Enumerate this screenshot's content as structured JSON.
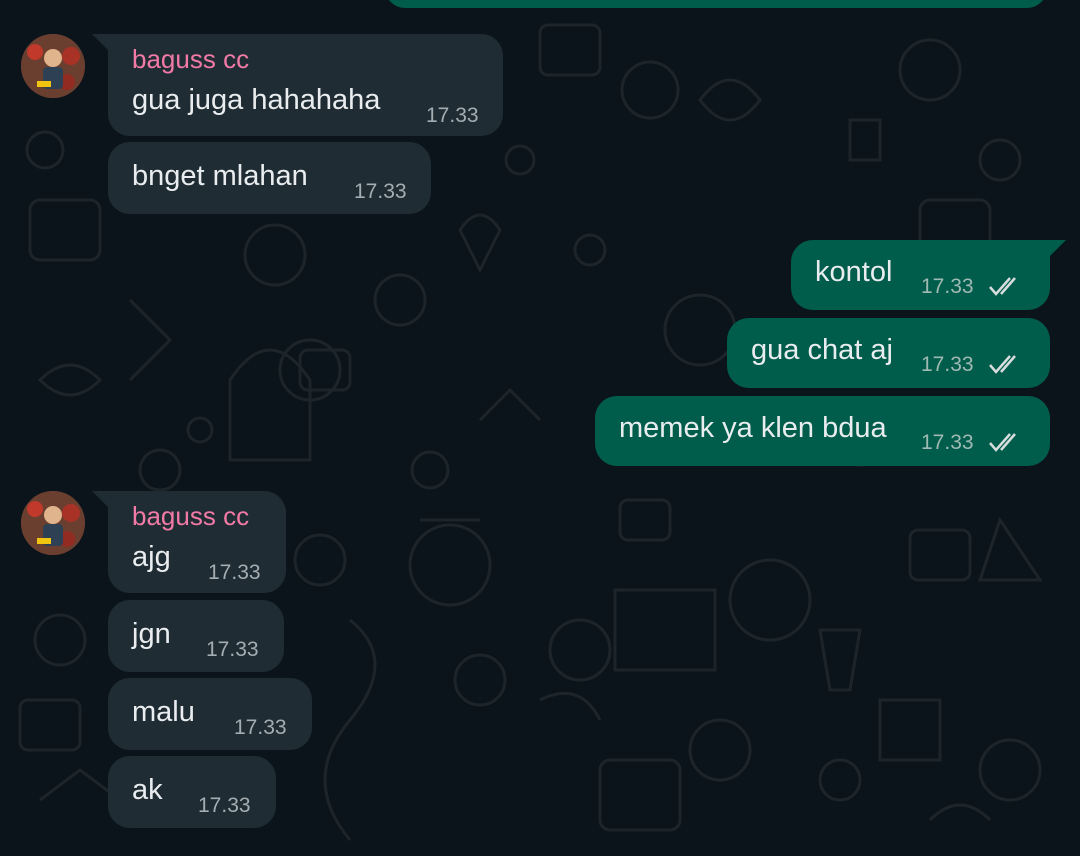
{
  "contact": {
    "name": "baguss cc",
    "name_color": "#f27aa6"
  },
  "colors": {
    "background": "#0b141a",
    "incoming_bubble": "#202c33",
    "outgoing_bubble": "#005c4b",
    "read_ticks": "#d7dcdd"
  },
  "messages": [
    {
      "direction": "incoming",
      "sender": "baguss cc",
      "text": "gua juga hahahaha",
      "time": "17.33"
    },
    {
      "direction": "incoming",
      "text": "bnget mlahan",
      "time": "17.33"
    },
    {
      "direction": "outgoing",
      "text": "kontol",
      "time": "17.33",
      "status": "read"
    },
    {
      "direction": "outgoing",
      "text": "gua chat aj",
      "time": "17.33",
      "status": "read"
    },
    {
      "direction": "outgoing",
      "text": "memek ya klen bdua",
      "time": "17.33",
      "status": "read"
    },
    {
      "direction": "incoming",
      "sender": "baguss cc",
      "text": "ajg",
      "time": "17.33"
    },
    {
      "direction": "incoming",
      "text": "jgn",
      "time": "17.33"
    },
    {
      "direction": "incoming",
      "text": "malu",
      "time": "17.33"
    },
    {
      "direction": "incoming",
      "text": "ak",
      "time": "17.33"
    }
  ]
}
